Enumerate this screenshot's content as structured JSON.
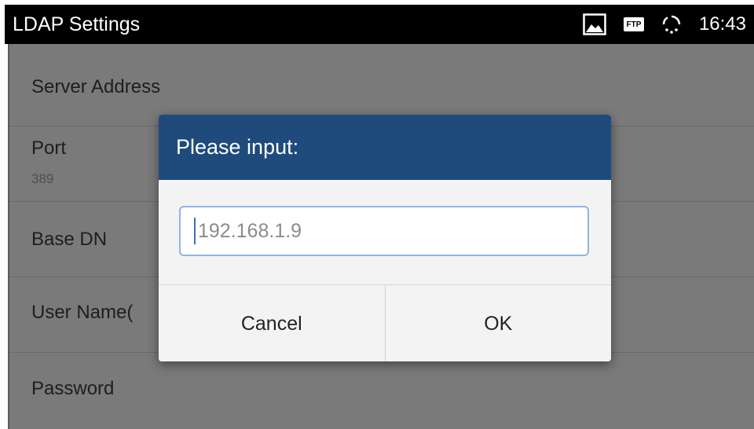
{
  "status_bar": {
    "title": "LDAP Settings",
    "ftp_label": "FTP",
    "time": "16:43",
    "icons": [
      "image-icon",
      "ftp-icon",
      "sync-icon"
    ]
  },
  "settings": {
    "rows": [
      {
        "label": "Server Address"
      },
      {
        "label": "Port",
        "value": "389"
      },
      {
        "label": "Base DN"
      },
      {
        "label": "User Name("
      },
      {
        "label": "Password"
      }
    ]
  },
  "dialog": {
    "title": "Please input:",
    "input_placeholder": "192.168.1.9",
    "cancel_label": "Cancel",
    "ok_label": "OK"
  },
  "colors": {
    "dialog_header": "#1e4b7c",
    "input_border": "#8fb6e6",
    "dimmed_background": "#7a7a7a"
  }
}
